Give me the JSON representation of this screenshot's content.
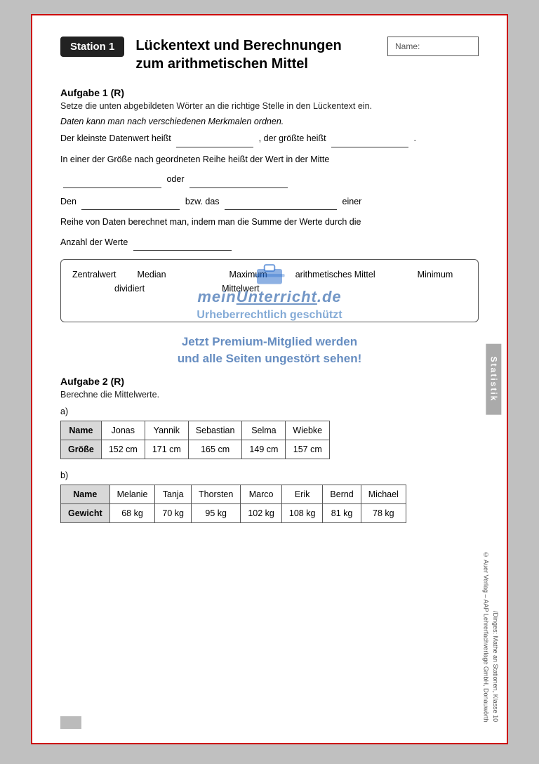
{
  "station": {
    "badge": "Station 1",
    "title_line1": "Lückentext und Berechnungen",
    "title_line2": "zum arithmetischen Mittel",
    "name_label": "Name:"
  },
  "aufgabe1": {
    "title": "Aufgabe 1",
    "suffix": "(R)",
    "instruction": "Setze die unten abgebildeten Wörter an die richtige Stelle in den Lückentext ein.",
    "line1": "Daten kann man nach verschiedenen Merkmalen ordnen.",
    "line2_pre": "Der kleinste Datenwert heißt",
    "line2_mid": ", der größte heißt",
    "line2_end": ".",
    "line3_pre": "In einer der Größe nach geordneten Reihe heißt der Wert in der Mitte",
    "line4_mid": "oder",
    "line5_pre": "Den",
    "line5_mid": "bzw. das",
    "line5_end": "einer",
    "line6": "Reihe von Daten berechnet man, indem man die Summe der Werte durch die",
    "line7_pre": "Anzahl der Werte",
    "words": [
      "Zentralwert",
      "Median",
      "Maximum",
      "arithmetisches Mittel",
      "Minimum",
      "dividiert",
      "Mittelwert"
    ]
  },
  "watermark": {
    "logo": "meinUnterricht.de",
    "text1": "Urheberrechtlich geschützt",
    "text2": "Jetzt Premium-Mitglied werden\nund alle Seiten ungestört sehen!"
  },
  "aufgabe2": {
    "title": "Aufgabe 2",
    "suffix": "(R)",
    "instruction": "Berechne die Mittelwerte.",
    "table_a_label": "a)",
    "table_a_headers": [
      "Name",
      "Jonas",
      "Yannik",
      "Sebastian",
      "Selma",
      "Wiebke"
    ],
    "table_a_row1_label": "Größe",
    "table_a_row1_values": [
      "152 cm",
      "171 cm",
      "165 cm",
      "149 cm",
      "157 cm"
    ],
    "table_b_label": "b)",
    "table_b_headers": [
      "Name",
      "Melanie",
      "Tanja",
      "Thorsten",
      "Marco",
      "Erik",
      "Bernd",
      "Michael"
    ],
    "table_b_row1_label": "Gewicht",
    "table_b_row1_values": [
      "68 kg",
      "70 kg",
      "95 kg",
      "102 kg",
      "108 kg",
      "81 kg",
      "78 kg"
    ]
  },
  "sidebar": {
    "label": "Statistik"
  },
  "footer": {
    "line1": "/Dinges: Mathe an Stationen, Klasse 10",
    "line2": "© Auer Verlag – AAP Lehrerfachverlage GmbH, Donauwörth"
  }
}
